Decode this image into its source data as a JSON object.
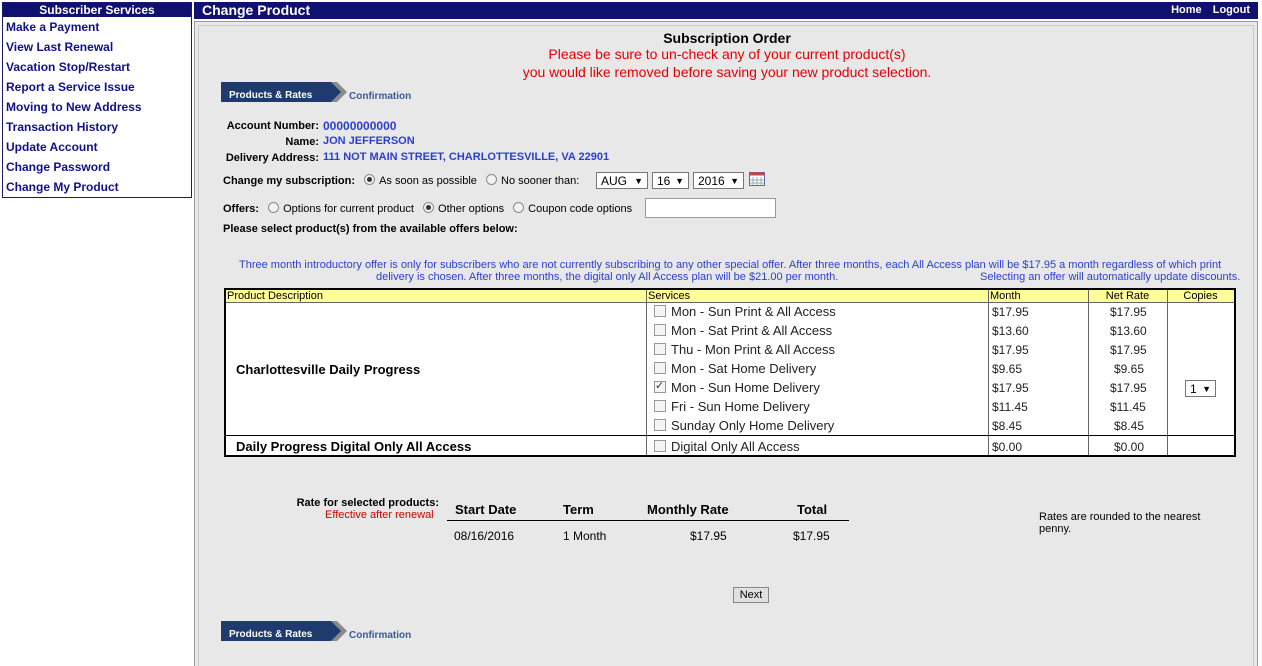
{
  "sidebar": {
    "title": "Subscriber Services",
    "items": [
      {
        "label": "Make a Payment"
      },
      {
        "label": "View Last Renewal"
      },
      {
        "label": "Vacation Stop/Restart"
      },
      {
        "label": "Report a Service Issue"
      },
      {
        "label": "Moving to New Address"
      },
      {
        "label": "Transaction History"
      },
      {
        "label": "Update Account"
      },
      {
        "label": "Change Password"
      },
      {
        "label": "Change My Product"
      }
    ]
  },
  "header": {
    "title": "Change Product",
    "home_label": "Home",
    "logout_label": "Logout",
    "color": "#10106e"
  },
  "order": {
    "title": "Subscription Order",
    "warning_line1": "Please be sure to un-check any of your current product(s)",
    "warning_line2": "you would like removed before saving your new product selection."
  },
  "steps": {
    "active": "Products & Rates",
    "next": "Confirmation"
  },
  "account": {
    "number_label": "Account Number:",
    "number": "00000000000",
    "name_label": "Name:",
    "name": "JON JEFFERSON",
    "address_label": "Delivery Address:",
    "address": "111 NOT MAIN STREET, CHARLOTTESVILLE, VA 22901"
  },
  "change_sub": {
    "label": "Change my subscription:",
    "option_asap": "As soon as possible",
    "option_nosooner": "No sooner than:",
    "selected": "As soon as possible",
    "month": "AUG",
    "day": "16",
    "year": "2016"
  },
  "offers": {
    "label": "Offers:",
    "option_current": "Options for current product",
    "option_other": "Other options",
    "option_coupon": "Coupon code options",
    "selected": "Other options",
    "coupon_value": ""
  },
  "select_prompt": "Please select product(s) from the available offers below:",
  "intro_note": {
    "line1": "Three month introductory offer is only for subscribers who are not currently subscribing to any other special offer. After three months, each All Access plan will be $17.95 a month regardless of which print",
    "line2": "delivery is chosen. After three months, the digital only All Access plan will be $21.00 per month.",
    "right": "Selecting an offer will automatically update discounts."
  },
  "table": {
    "headers": {
      "product": "Product Description",
      "services": "Services",
      "month": "Month",
      "net_rate": "Net Rate",
      "copies": "Copies"
    },
    "products": [
      {
        "name": "Charlottesville Daily Progress",
        "copies": "1",
        "services": [
          {
            "label": "Mon - Sun Print & All Access",
            "month": "$17.95",
            "net": "$17.95",
            "checked": false,
            "disabled": true
          },
          {
            "label": "Mon - Sat Print & All Access",
            "month": "$13.60",
            "net": "$13.60",
            "checked": false,
            "disabled": true
          },
          {
            "label": "Thu - Mon Print & All Access",
            "month": "$17.95",
            "net": "$17.95",
            "checked": false,
            "disabled": true
          },
          {
            "label": "Mon - Sat Home Delivery",
            "month": "$9.65",
            "net": "$9.65",
            "checked": false,
            "disabled": false
          },
          {
            "label": "Mon - Sun Home Delivery",
            "month": "$17.95",
            "net": "$17.95",
            "checked": true,
            "disabled": false
          },
          {
            "label": "Fri - Sun Home Delivery",
            "month": "$11.45",
            "net": "$11.45",
            "checked": false,
            "disabled": false
          },
          {
            "label": "Sunday Only Home Delivery",
            "month": "$8.45",
            "net": "$8.45",
            "checked": false,
            "disabled": false
          }
        ]
      },
      {
        "name": "Daily Progress Digital Only All Access",
        "copies": "",
        "services": [
          {
            "label": "Digital Only All Access",
            "month": "$0.00",
            "net": "$0.00",
            "checked": false,
            "disabled": false
          }
        ]
      }
    ]
  },
  "rates": {
    "label": "Rate for selected products:",
    "sublabel": "Effective after renewal",
    "headers": {
      "start": "Start Date",
      "term": "Term",
      "monthly": "Monthly Rate",
      "total": "Total"
    },
    "row": {
      "start": "08/16/2016",
      "term": "1 Month",
      "monthly": "$17.95",
      "total": "$17.95"
    },
    "note": "Rates are rounded to the nearest penny."
  },
  "next_label": "Next"
}
